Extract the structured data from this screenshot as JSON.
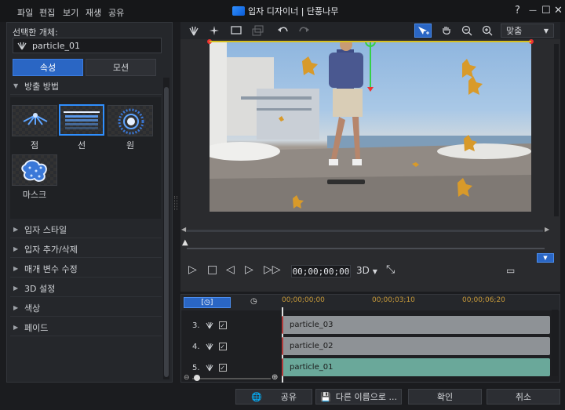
{
  "menu": [
    "파일",
    "편집",
    "보기",
    "재생",
    "공유"
  ],
  "title": "입자 디자이너 | 단풍나무",
  "window_controls": {
    "help": "?",
    "minimize": "—",
    "maximize": "☐",
    "close": "✕"
  },
  "selected_object": {
    "label": "선택한 개체:",
    "value": "particle_01"
  },
  "tabs": {
    "properties": "속성",
    "motion": "모션"
  },
  "sections": {
    "emission": "방출 방법",
    "particle_style": "입자 스타일",
    "add_delete": "입자 추가/삭제",
    "params": "매개 변수 수정",
    "settings_3d": "3D 설정",
    "color": "색상",
    "fade": "페이드"
  },
  "emission_options": [
    "점",
    "선",
    "원",
    "마스크"
  ],
  "toolbar": {
    "zoom": "맞춤"
  },
  "playback": {
    "timecode": "00;00;00;00",
    "mode": "3D"
  },
  "timeline": {
    "times": [
      "00;00;00;00",
      "00;00;03;10",
      "00;00;06;20"
    ],
    "tracks": [
      {
        "num": "3.",
        "clip": "particle_03"
      },
      {
        "num": "4.",
        "clip": "particle_02"
      },
      {
        "num": "5.",
        "clip": "particle_01"
      }
    ]
  },
  "buttons": {
    "share": "공유",
    "save_as": "다른 이름으로 ...",
    "ok": "확인",
    "cancel": "취소"
  },
  "colors": {
    "accent": "#2a66c4",
    "clip_gray": "#8e9296",
    "clip_teal": "#6aa89a",
    "time_gold": "#c79a3a"
  }
}
